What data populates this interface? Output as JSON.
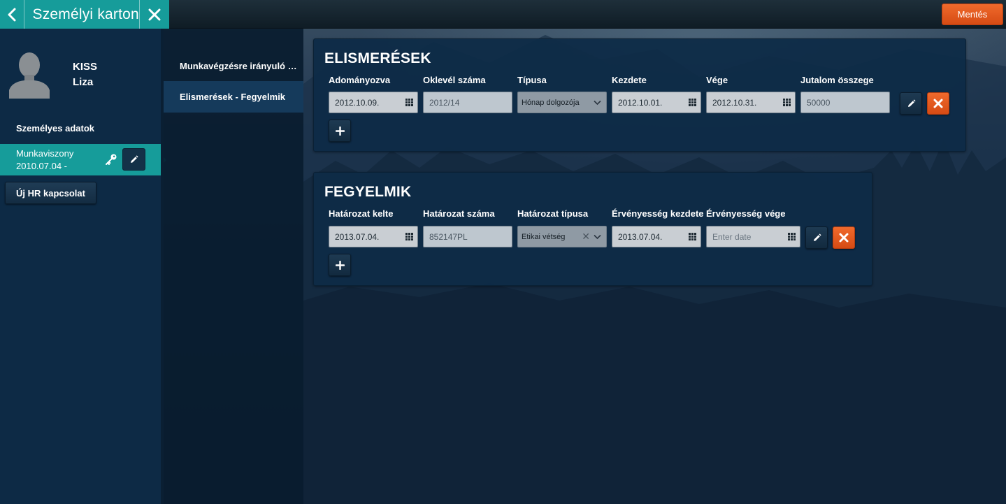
{
  "header": {
    "title": "Személyi karton",
    "save_label": "Mentés"
  },
  "profile": {
    "last_name": "KISS",
    "first_name": "Liza"
  },
  "sidebar": {
    "personal_data_label": "Személyes adatok",
    "employment": {
      "label": "Munkaviszony",
      "date": "2010.07.04 -"
    },
    "new_hr_label": "Új HR kapcsolat"
  },
  "subnav": {
    "items": [
      {
        "label": "Munkavégzésre irányuló adatok"
      },
      {
        "label": "Elismerések - Fegyelmik"
      }
    ]
  },
  "awards": {
    "title": "ELISMERÉSEK",
    "columns": [
      "Adományozva",
      "Oklevél száma",
      "Típusa",
      "Kezdete",
      "Vége",
      "Jutalom összege"
    ],
    "row": {
      "granted": "2012.10.09.",
      "certificate_no": "2012/14",
      "type": "Hónap dolgozója",
      "start": "2012.10.01.",
      "end": "2012.10.31.",
      "amount": "50000"
    }
  },
  "disciplinary": {
    "title": "FEGYELMIK",
    "columns": [
      "Határozat kelte",
      "Határozat száma",
      "Határozat típusa",
      "Érvényesség kezdete",
      "Érvényesség vége"
    ],
    "row": {
      "decision_date": "2013.07.04.",
      "decision_no": "852147PL",
      "decision_type": "Etikai vétség",
      "valid_from": "2013.07.04.",
      "valid_to": ""
    },
    "valid_to_placeholder": "Enter date"
  },
  "colors": {
    "accent_teal": "#169c9a",
    "accent_orange": "#e0561a",
    "panel": "#0e2b47",
    "sidebar": "#0d2a45"
  }
}
